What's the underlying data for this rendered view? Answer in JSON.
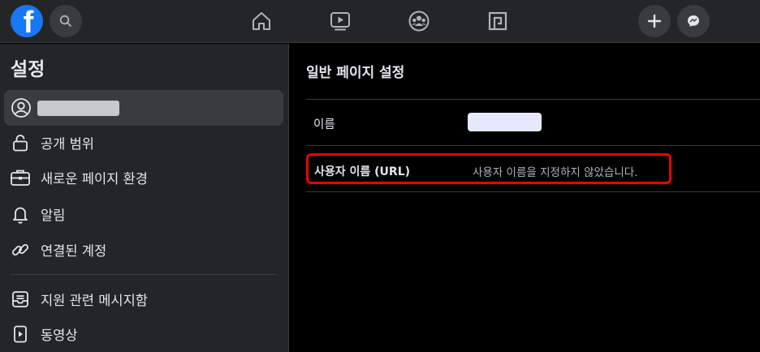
{
  "topbar": {
    "logo_letter": "f",
    "icons": [
      "search-icon",
      "home-icon",
      "watch-icon",
      "groups-icon",
      "gaming-icon",
      "plus-icon",
      "messenger-icon"
    ]
  },
  "sidebar": {
    "title": "설정",
    "items": [
      {
        "label": "공개 범위",
        "icon": "lock-icon"
      },
      {
        "label": "새로운 페이지 환경",
        "icon": "briefcase-icon"
      },
      {
        "label": "알림",
        "icon": "bell-icon"
      },
      {
        "label": "연결된 계정",
        "icon": "link-icon"
      },
      {
        "label": "지원 관련 메시지함",
        "icon": "inbox-icon"
      },
      {
        "label": "동영상",
        "icon": "video-icon"
      }
    ]
  },
  "main": {
    "title": "일반 페이지 설정",
    "name_label": "이름",
    "url_label": "사용자 이름 (URL)",
    "url_value": "사용자 이름을 지정하지 않았습니다."
  },
  "colors": {
    "brand": "#1877f2",
    "highlight": "#e00000",
    "surface": "#242526"
  }
}
